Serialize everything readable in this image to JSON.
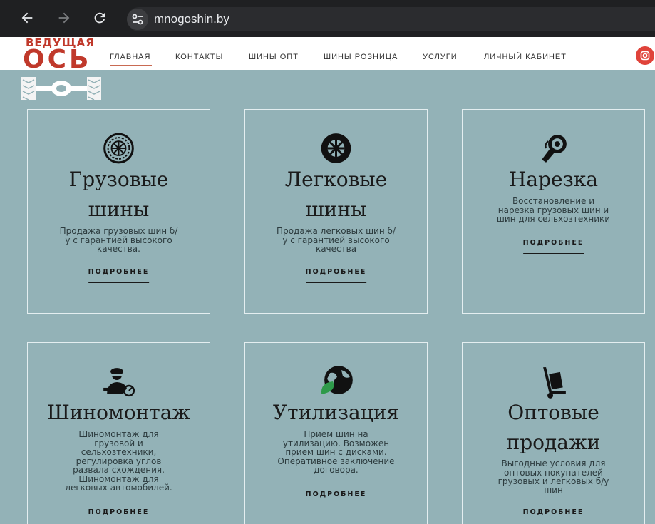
{
  "browser": {
    "url": "mnogoshin.by",
    "back_icon": "arrow-left-icon",
    "forward_icon": "arrow-right-icon",
    "reload_icon": "reload-icon",
    "site_info_icon": "tune-icon"
  },
  "logo": {
    "line1": "ВЕДУЩАЯ",
    "line2": "ОСЬ"
  },
  "nav": {
    "items": [
      {
        "label": "ГЛАВНАЯ"
      },
      {
        "label": "КОНТАКТЫ"
      },
      {
        "label": "ШИНЫ ОПТ"
      },
      {
        "label": "ШИНЫ РОЗНИЦА"
      },
      {
        "label": "УСЛУГИ"
      },
      {
        "label": "ЛИЧНЫЙ КАБИНЕТ"
      }
    ],
    "social_icon": "instagram-icon"
  },
  "colors": {
    "background": "#93b2b7",
    "brand": "#c0392b",
    "instagram": "#e0433a"
  },
  "cards": [
    {
      "title1": "Грузовые",
      "title2": "шины",
      "desc": [
        "Продажа грузовых шин б/",
        "у с гарантией высокого",
        "качества."
      ],
      "more": "ПОДРОБНЕЕ",
      "icon": "truck-tire-icon"
    },
    {
      "title1": "Легковые",
      "title2": "шины",
      "desc": [
        "Продажа легковых шин б/",
        "у с гарантией высокого",
        "качества"
      ],
      "more": "ПОДРОБНЕЕ",
      "icon": "car-tire-icon"
    },
    {
      "title1": "Нарезка",
      "title2": "",
      "desc": [
        "Восстановление и",
        "нарезка грузовых шин и",
        "шин для сельхозтехники"
      ],
      "more": "ПОДРОБНЕЕ",
      "icon": "grinder-icon"
    },
    {
      "title1": "Шиномонтаж",
      "title2": "",
      "desc": [
        "Шиномонтаж для",
        "грузовой и",
        "сельхозтехники,",
        "регулировка углов",
        "развала схождения.",
        "Шиномонтаж для",
        "легковых автомобилей."
      ],
      "more": "ПОДРОБНЕЕ",
      "icon": "mechanic-icon"
    },
    {
      "title1": "Утилизация",
      "title2": "",
      "desc": [
        "Прием шин на",
        "утилизацию. Возможен",
        "прием шин с дисками.",
        "Оперативное заключение",
        "договора."
      ],
      "more": "ПОДРОБНЕЕ",
      "icon": "eco-globe-icon"
    },
    {
      "title1": "Оптовые",
      "title2": "продажи",
      "desc": [
        "Выгодные условия для",
        "оптовых покупателей",
        "грузовых и легковых б/у",
        "шин"
      ],
      "more": "ПОДРОБНЕЕ",
      "icon": "hand-truck-icon"
    }
  ]
}
